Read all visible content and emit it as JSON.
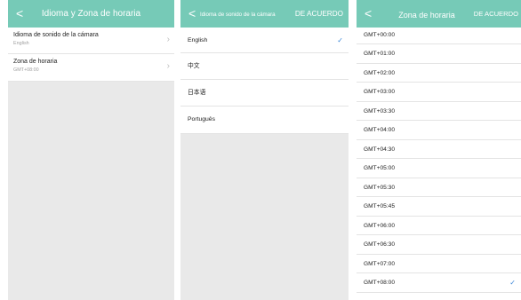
{
  "panel1": {
    "back_icon": "chevron-left-icon",
    "title": "Idioma y Zona de horaria",
    "rows": [
      {
        "title": "Idioma de sonido de la cámara",
        "subtitle": "English",
        "chevron": "›"
      },
      {
        "title": "Zona de horaria",
        "subtitle": "GMT+08:00",
        "chevron": "›"
      }
    ]
  },
  "panel2": {
    "back_icon": "chevron-left-icon",
    "title": "Idioma de sonido de la cámara",
    "ok_label": "DE ACUERDO",
    "languages": [
      {
        "label": "English",
        "selected": true
      },
      {
        "label": "中文",
        "selected": false
      },
      {
        "label": "日本语",
        "selected": false
      },
      {
        "label": "Português",
        "selected": false
      }
    ],
    "check": "✓"
  },
  "panel3": {
    "back_icon": "chevron-left-icon",
    "title": "Zona de horaria",
    "ok_label": "DE ACUERDO",
    "zones": [
      {
        "label": "GMT+00:00",
        "selected": false
      },
      {
        "label": "GMT+01:00",
        "selected": false
      },
      {
        "label": "GMT+02:00",
        "selected": false
      },
      {
        "label": "GMT+03:00",
        "selected": false
      },
      {
        "label": "GMT+03:30",
        "selected": false
      },
      {
        "label": "GMT+04:00",
        "selected": false
      },
      {
        "label": "GMT+04:30",
        "selected": false
      },
      {
        "label": "GMT+05:00",
        "selected": false
      },
      {
        "label": "GMT+05:30",
        "selected": false
      },
      {
        "label": "GMT+05:45",
        "selected": false
      },
      {
        "label": "GMT+06:00",
        "selected": false
      },
      {
        "label": "GMT+06:30",
        "selected": false
      },
      {
        "label": "GMT+07:00",
        "selected": false
      },
      {
        "label": "GMT+08:00",
        "selected": true
      }
    ],
    "check": "✓"
  },
  "colors": {
    "header": "#76cab7",
    "background": "#e9e9e9",
    "check": "#3a86d8"
  }
}
